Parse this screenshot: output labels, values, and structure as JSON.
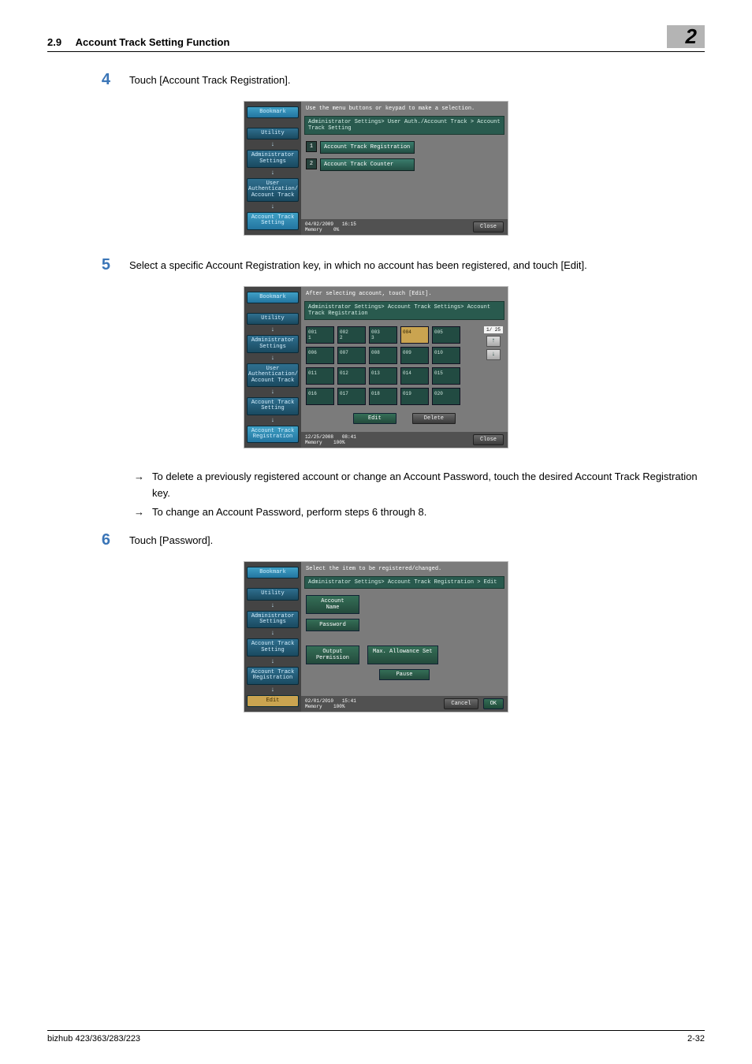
{
  "header": {
    "section": "2.9",
    "title": "Account Track Setting Function",
    "chapter": "2"
  },
  "steps": {
    "s4": {
      "num": "4",
      "text": "Touch [Account Track Registration]."
    },
    "s5": {
      "num": "5",
      "text": "Select a specific Account Registration key, in which no account has been registered, and touch [Edit]."
    },
    "s6": {
      "num": "6",
      "text": "Touch [Password]."
    }
  },
  "bullets": {
    "b1": "To delete a previously registered account or change an Account Password, touch the desired Account Track Registration key.",
    "b2": "To change an Account Password, perform steps 6 through 8."
  },
  "screen1": {
    "top": "Use the menu buttons or keypad to make a selection.",
    "bc": "Administrator Settings> User Auth./Account Track > Account Track Setting",
    "m1_num": "1",
    "m1": "Account Track Registration",
    "m2_num": "2",
    "m2": "Account Track Counter",
    "side": {
      "bookmark": "Bookmark",
      "utility": "Utility",
      "admin": "Administrator\nSettings",
      "user": "User\nAuthentication/\nAccount Track",
      "acct": "Account Track\nSetting"
    },
    "foot_date": "04/02/2009",
    "foot_time": "16:15",
    "foot_mem": "Memory",
    "foot_memv": "0%",
    "close": "Close"
  },
  "screen2": {
    "top": "After selecting account, touch [Edit].",
    "bc": "Administrator Settings> Account Track Settings> Account Track Registration",
    "cells": [
      {
        "n": "001",
        "s": "1"
      },
      {
        "n": "002",
        "s": "2"
      },
      {
        "n": "003",
        "s": "3"
      },
      {
        "n": "004",
        "s": "",
        "sel": true
      },
      {
        "n": "005",
        "s": ""
      },
      {
        "n": "006",
        "s": ""
      },
      {
        "n": "007",
        "s": ""
      },
      {
        "n": "008",
        "s": ""
      },
      {
        "n": "009",
        "s": ""
      },
      {
        "n": "010",
        "s": ""
      },
      {
        "n": "011",
        "s": ""
      },
      {
        "n": "012",
        "s": ""
      },
      {
        "n": "013",
        "s": ""
      },
      {
        "n": "014",
        "s": ""
      },
      {
        "n": "015",
        "s": ""
      },
      {
        "n": "016",
        "s": ""
      },
      {
        "n": "017",
        "s": ""
      },
      {
        "n": "018",
        "s": ""
      },
      {
        "n": "019",
        "s": ""
      },
      {
        "n": "020",
        "s": ""
      }
    ],
    "pager": "1/ 25",
    "edit": "Edit",
    "delete": "Delete",
    "side": {
      "bookmark": "Bookmark",
      "utility": "Utility",
      "admin": "Administrator\nSettings",
      "user": "User\nAuthentication/\nAccount Track",
      "acct": "Account Track\nSetting",
      "reg": "Account Track\nRegistration"
    },
    "foot_date": "12/25/2008",
    "foot_time": "08:41",
    "foot_mem": "Memory",
    "foot_memv": "100%",
    "close": "Close"
  },
  "screen3": {
    "top": "Select the item to be registered/changed.",
    "bc": "Administrator Settings> Account Track Registration > Edit",
    "acctname": "Account\nName",
    "pw": "Password",
    "perm": "Output\nPermission",
    "max": "Max. Allowance Set",
    "pause": "Pause",
    "side": {
      "bookmark": "Bookmark",
      "utility": "Utility",
      "admin": "Administrator\nSettings",
      "acct": "Account Track\nSetting",
      "reg": "Account Track\nRegistration",
      "edit": "Edit"
    },
    "foot_date": "02/01/2010",
    "foot_time": "15:41",
    "foot_mem": "Memory",
    "foot_memv": "100%",
    "cancel": "Cancel",
    "ok": "OK"
  },
  "footer": {
    "model": "bizhub 423/363/283/223",
    "page": "2-32"
  },
  "arrows": {
    "right": "→",
    "down": "↓",
    "up": "↑"
  }
}
